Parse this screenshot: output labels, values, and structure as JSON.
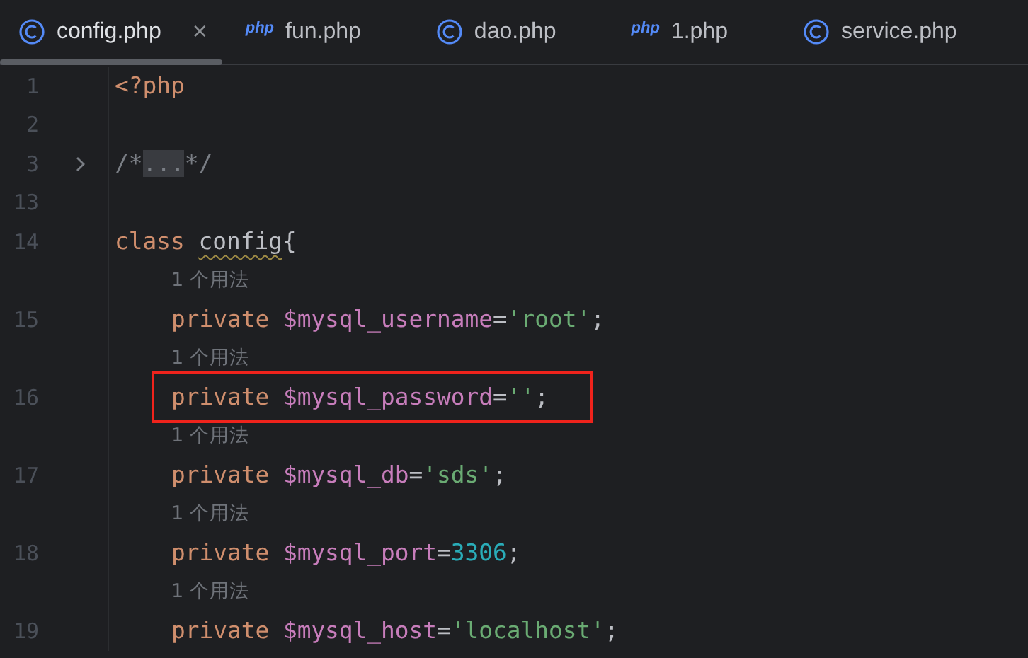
{
  "tabs": [
    {
      "label": "config.php",
      "kind": "class",
      "selected": true,
      "close": "×"
    },
    {
      "label": "fun.php",
      "kind": "php",
      "badge": "php",
      "selected": false
    },
    {
      "label": "dao.php",
      "kind": "class",
      "selected": false
    },
    {
      "label": "1.php",
      "kind": "php",
      "badge": "php",
      "selected": false
    },
    {
      "label": "service.php",
      "kind": "class",
      "selected": false
    }
  ],
  "lines": [
    {
      "kind": "code",
      "number": "1",
      "tokens": [
        {
          "text": "<?php",
          "kind": "keyword"
        }
      ]
    },
    {
      "kind": "code",
      "number": "2"
    },
    {
      "kind": "code",
      "number": "3",
      "folded": true,
      "tokens": [
        {
          "text": "/*",
          "kind": "comment"
        },
        {
          "text": "...",
          "kind": "fold"
        },
        {
          "text": "*/",
          "kind": "comment"
        }
      ]
    },
    {
      "kind": "code",
      "number": "13"
    },
    {
      "kind": "code",
      "number": "14",
      "tokens": [
        {
          "text": "class ",
          "kind": "keyword"
        },
        {
          "text": "config",
          "kind": "warned"
        },
        {
          "text": "{",
          "kind": "punct"
        }
      ],
      "children": [
        {
          "kind": "hint",
          "text": "1 个用法"
        },
        {
          "kind": "code",
          "number": "15",
          "tokens": [
            {
              "text": "private ",
              "kind": "keyword"
            },
            {
              "text": "$mysql_username",
              "kind": "variable"
            },
            {
              "text": "=",
              "kind": "punct"
            },
            {
              "text": "'root'",
              "kind": "string"
            },
            {
              "text": ";",
              "kind": "punct"
            }
          ]
        },
        {
          "kind": "hint",
          "text": "1 个用法"
        },
        {
          "kind": "code",
          "number": "16",
          "highlighted": true,
          "tokens": [
            {
              "text": "private ",
              "kind": "keyword"
            },
            {
              "text": "$mysql_password",
              "kind": "variable"
            },
            {
              "text": "=",
              "kind": "punct"
            },
            {
              "text": "''",
              "kind": "string"
            },
            {
              "text": ";",
              "kind": "punct"
            }
          ]
        },
        {
          "kind": "hint",
          "text": "1 个用法"
        },
        {
          "kind": "code",
          "number": "17",
          "tokens": [
            {
              "text": "private ",
              "kind": "keyword"
            },
            {
              "text": "$mysql_db",
              "kind": "variable"
            },
            {
              "text": "=",
              "kind": "punct"
            },
            {
              "text": "'sds'",
              "kind": "string"
            },
            {
              "text": ";",
              "kind": "punct"
            }
          ]
        },
        {
          "kind": "hint",
          "text": "1 个用法"
        },
        {
          "kind": "code",
          "number": "18",
          "tokens": [
            {
              "text": "private ",
              "kind": "keyword"
            },
            {
              "text": "$mysql_port",
              "kind": "variable"
            },
            {
              "text": "=",
              "kind": "punct"
            },
            {
              "text": "3306",
              "kind": "number"
            },
            {
              "text": ";",
              "kind": "punct"
            }
          ]
        },
        {
          "kind": "hint",
          "text": "1 个用法"
        },
        {
          "kind": "code",
          "number": "19",
          "tokens": [
            {
              "text": "private ",
              "kind": "keyword"
            },
            {
              "text": "$mysql_host",
              "kind": "variable"
            },
            {
              "text": "=",
              "kind": "punct"
            },
            {
              "text": "'localhost'",
              "kind": "string"
            },
            {
              "text": ";",
              "kind": "punct"
            }
          ]
        }
      ]
    }
  ]
}
